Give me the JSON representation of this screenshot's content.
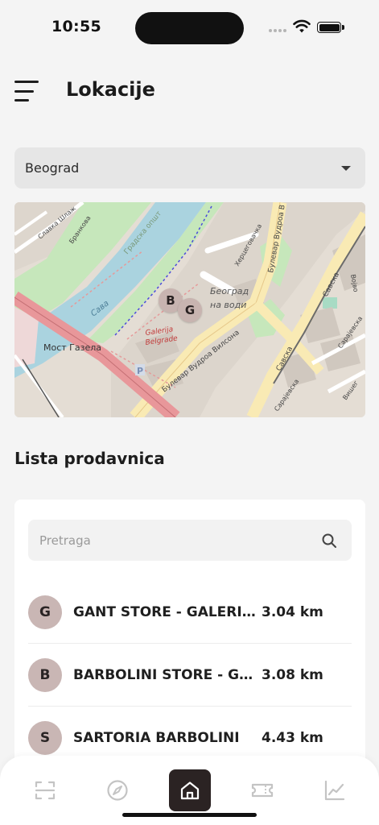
{
  "status_bar": {
    "time": "10:55"
  },
  "header": {
    "title": "Lokacije"
  },
  "city_select": {
    "selected": "Beograd"
  },
  "map": {
    "labels": {
      "sava_river": "Сава",
      "most_gazela": "Мост Газела",
      "galerija_line1": "Galerija",
      "galerija_line2": "Belgrade",
      "beograd_na_vodi_line1": "Београд",
      "beograd_na_vodi_line2": "на води",
      "bulevar_vudroa_vilsona": "Булевар Вудроа Вилсона",
      "bulevar_vudroa_v": "Булевар Вудроа В",
      "gradska_opstina": "Градска општ",
      "hercegovacka": "Херцеговачка",
      "savska_lower": "Савска",
      "savska_upper": "Савска",
      "sarajevska_lower": "Сарајевска",
      "sarajevska_right": "Сарајевска",
      "brankova": "Бранкова",
      "slavka_shlo": "Славка Шлаж",
      "vojvo": "Војво",
      "visheg": "Вишег",
      "parking_symbol": "P"
    },
    "markers": [
      "B",
      "G"
    ]
  },
  "store_list": {
    "title": "Lista prodavnica",
    "search_placeholder": "Pretraga",
    "search_value": "",
    "items": [
      {
        "initial": "G",
        "name": "GANT STORE - GALERIJA",
        "distance": "3.04 km"
      },
      {
        "initial": "B",
        "name": "BARBOLINI STORE - GALERIJA",
        "distance": "3.08 km"
      },
      {
        "initial": "S",
        "name": "SARTORIA BARBOLINI",
        "distance": "4.43 km"
      }
    ]
  },
  "bottom_nav": {
    "items": [
      {
        "icon": "scan-icon",
        "active": false
      },
      {
        "icon": "compass-icon",
        "active": false
      },
      {
        "icon": "home-icon",
        "active": true
      },
      {
        "icon": "ticket-icon",
        "active": false
      },
      {
        "icon": "chart-icon",
        "active": false
      }
    ]
  },
  "colors": {
    "background": "#f4f4f4",
    "marker": "#c8b4b0",
    "avatar": "#c9b6b4",
    "nav_active": "#2b2323",
    "river": "#aad3df",
    "park": "#c6e7bb",
    "main_road": "#f9eab4",
    "bridge_road": "#e8979a"
  }
}
